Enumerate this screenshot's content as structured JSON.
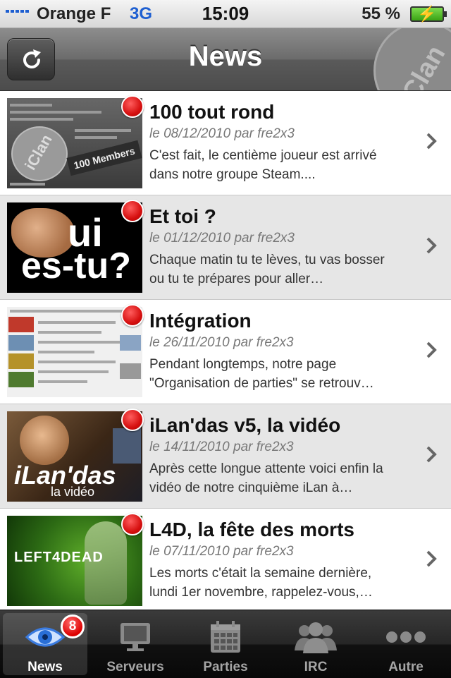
{
  "status_bar": {
    "carrier": "Orange F",
    "network": "3G",
    "time": "15:09",
    "battery": "55 %"
  },
  "nav": {
    "title": "News",
    "logo_text": "iClan"
  },
  "colors": {
    "unread": "#d61010",
    "accent_blue": "#1e5fd1"
  },
  "news": [
    {
      "title": "100 tout rond",
      "meta": "le 08/12/2010 par fre2x3",
      "excerpt": "C'est fait, le centième joueur est arrivé dans notre groupe Steam....",
      "unread": true,
      "thumb": {
        "logo": "iClan",
        "badge": "100 Members"
      }
    },
    {
      "title": "Et toi ?",
      "meta": "le 01/12/2010 par fre2x3",
      "excerpt": "Chaque matin tu te lèves, tu vas bosser ou tu te prépares pour aller…",
      "unread": true,
      "thumb": {
        "line1": "ui",
        "line2": "es-tu?"
      }
    },
    {
      "title": "Intégration",
      "meta": "le 26/11/2010 par fre2x3",
      "excerpt": "Pendant longtemps, notre page \"Organisation de parties\" se retrouv…",
      "unread": true,
      "thumb": {}
    },
    {
      "title": "iLan'das v5, la vidéo",
      "meta": "le 14/11/2010 par fre2x3",
      "excerpt": "Après cette longue attente voici enfin la vidéo de notre cinquième iLan à…",
      "unread": true,
      "thumb": {
        "title": "iLan'das",
        "subtitle": "la vidéo"
      }
    },
    {
      "title": "L4D, la fête des morts",
      "meta": "le 07/11/2010 par fre2x3",
      "excerpt": "Les morts c'était la semaine dernière, lundi 1er novembre, rappelez-vous,…",
      "unread": true,
      "thumb": {
        "title": "LEFT4DEAD"
      }
    }
  ],
  "tabs": [
    {
      "label": "News",
      "icon": "eye-icon",
      "badge": "8",
      "active": true
    },
    {
      "label": "Serveurs",
      "icon": "monitor-icon"
    },
    {
      "label": "Parties",
      "icon": "calendar-icon"
    },
    {
      "label": "IRC",
      "icon": "people-icon"
    },
    {
      "label": "Autre",
      "icon": "more-icon"
    }
  ]
}
